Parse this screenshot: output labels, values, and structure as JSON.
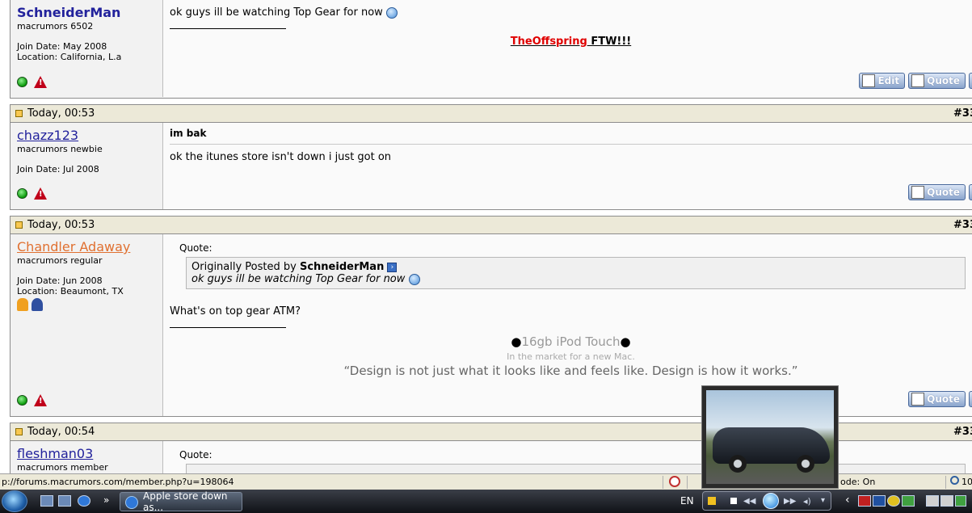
{
  "posts": [
    {
      "user": {
        "name": "SchneiderMan",
        "title": "macrumors 6502",
        "join": "Join Date: May 2008",
        "location": "Location: California, L.a"
      },
      "message": "ok guys ill be watching Top Gear for now",
      "signature": {
        "band": "TheOffspring",
        "suffix": " FTW!!!"
      },
      "buttons": {
        "edit": "Edit",
        "quote": "Quote"
      }
    },
    {
      "header": {
        "date": "Today, 00:53",
        "number": "#33"
      },
      "user": {
        "name": "chazz123",
        "title": "macrumors newbie",
        "join": "Join Date: Jul 2008"
      },
      "message_title": "im bak",
      "message": "ok the itunes store isn't down i just got on",
      "buttons": {
        "quote": "Quote"
      }
    },
    {
      "header": {
        "date": "Today, 00:53",
        "number": "#33"
      },
      "user": {
        "name": "Chandler Adaway",
        "title": "macrumors regular",
        "join": "Join Date: Jun 2008",
        "location": "Location: Beaumont, TX"
      },
      "quote": {
        "label": "Quote:",
        "prefix": "Originally Posted by ",
        "author": "SchneiderMan",
        "text": "ok guys ill be watching Top Gear for now"
      },
      "message": "What's on top gear ATM?",
      "signature": {
        "line1": "16gb iPod Touch",
        "line2": "In the market for a new Mac.",
        "line3": "“Design is not just what it looks like and feels like. Design is how it works.”"
      },
      "buttons": {
        "quote": "Quote"
      }
    },
    {
      "header": {
        "date": "Today, 00:54",
        "number": "#33"
      },
      "user": {
        "name": "fleshman03",
        "title": "macrumors member"
      },
      "quote": {
        "label": "Quote:"
      }
    }
  ],
  "statusbar": {
    "url": "p://forums.macrumors.com/member.php?u=198064",
    "mode": "ode: On",
    "zoom": "10"
  },
  "taskbar": {
    "task_label": "Apple store down as...",
    "lang": "EN"
  }
}
